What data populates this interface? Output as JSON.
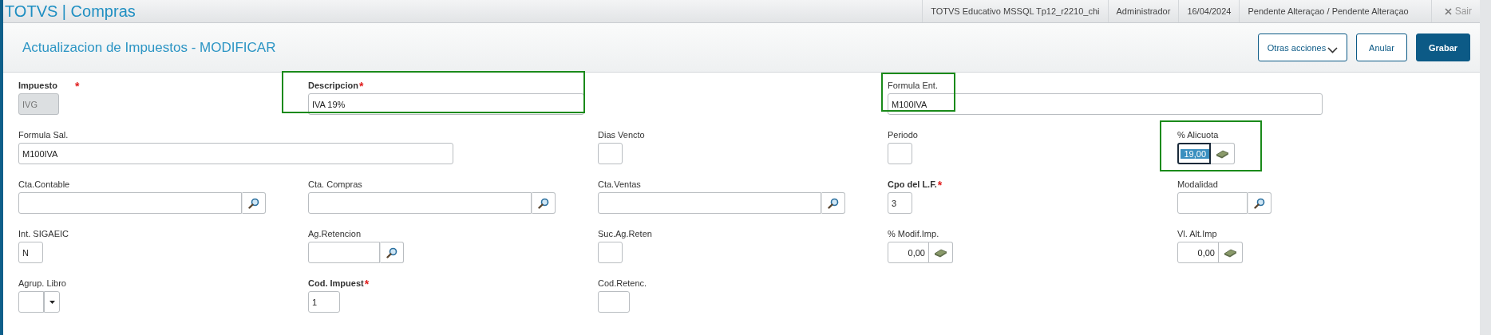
{
  "app_title": "TOTVS | Compras",
  "status_items": [
    "TOTVS Educativo MSSQL Tp12_r2210_chi",
    "Administrador",
    "16/04/2024",
    "Pendente Alteraçao / Pendente Alteraçao"
  ],
  "exit_label": "Sair",
  "page_title": "Actualizacion de Impuestos - MODIFICAR",
  "actions": [
    {
      "label": "Otras acciones",
      "kind": "menu"
    },
    {
      "label": "Anular",
      "kind": "outline"
    },
    {
      "label": "Grabar",
      "kind": "primary"
    }
  ],
  "form_rows": [
    [
      {
        "label": "Impuesto",
        "kind": "code",
        "value": "IVG",
        "required_mark": "*",
        "disabled": true,
        "highlighted": false
      },
      {
        "label": "Descripcion",
        "kind": "text",
        "value": "IVA 19%",
        "required_mark": "*",
        "disabled": false,
        "highlighted": true
      },
      {
        "label": "Formula Ent.",
        "kind": "text",
        "value": "M100IVA",
        "disabled": false,
        "highlighted": true
      }
    ],
    [
      {
        "label": "Formula Sal.",
        "kind": "text",
        "value": "M100IVA",
        "disabled": false,
        "highlighted": false
      },
      {
        "label": "Dias Vencto",
        "kind": "code",
        "disabled": false,
        "highlighted": false
      },
      {
        "label": "Periodo",
        "kind": "code",
        "disabled": false,
        "highlighted": false
      },
      {
        "label": "% Alicuota",
        "kind": "number",
        "value": "19,00",
        "disabled": false,
        "highlighted": true,
        "focused": true
      }
    ],
    [
      {
        "label": "Cta.Contable",
        "kind": "lookup",
        "disabled": false,
        "highlighted": false
      },
      {
        "label": "Cta. Compras",
        "kind": "lookup",
        "disabled": false,
        "highlighted": false
      },
      {
        "label": "Cta.Ventas",
        "kind": "lookup",
        "disabled": false,
        "highlighted": false
      },
      {
        "label": "Cpo del L.F.",
        "kind": "code",
        "value": "3",
        "required_mark": "*",
        "disabled": false,
        "highlighted": false
      },
      {
        "label": "Modalidad",
        "kind": "lookup",
        "disabled": false,
        "highlighted": false
      }
    ],
    [
      {
        "label": "Int. SIGAEIC",
        "kind": "code",
        "value": "N",
        "disabled": false,
        "highlighted": false
      },
      {
        "label": "Ag.Retencion",
        "kind": "lookup",
        "disabled": false,
        "highlighted": false
      },
      {
        "label": "Suc.Ag.Reten",
        "kind": "code",
        "disabled": false,
        "highlighted": false
      },
      {
        "label": "% Modif.Imp.",
        "kind": "number",
        "value": "0,00",
        "disabled": false,
        "highlighted": false
      },
      {
        "label": "Vl. Alt.Imp",
        "kind": "number",
        "value": "0,00",
        "disabled": false,
        "highlighted": false
      }
    ],
    [
      {
        "label": "Agrup. Libro",
        "kind": "select",
        "disabled": false,
        "highlighted": false
      },
      {
        "label": "Cod. Impuest",
        "kind": "code",
        "value": "1",
        "required_mark": "*",
        "disabled": false,
        "highlighted": false
      },
      {
        "label": "Cod.Retenc.",
        "kind": "code",
        "disabled": false,
        "highlighted": false
      }
    ]
  ]
}
